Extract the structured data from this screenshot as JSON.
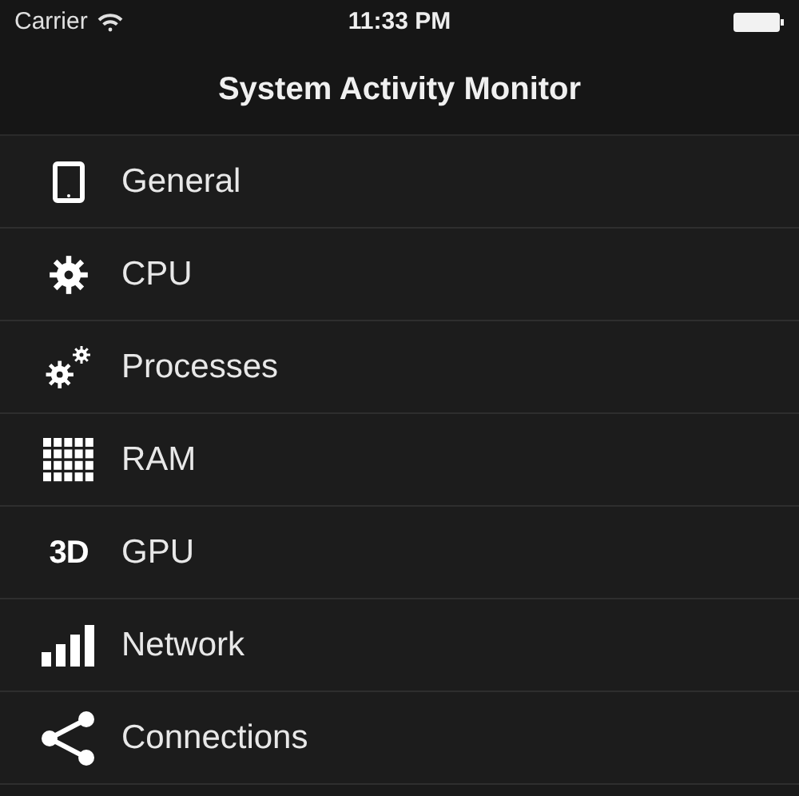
{
  "status_bar": {
    "carrier": "Carrier",
    "time": "11:33 PM"
  },
  "nav_bar": {
    "title": "System Activity Monitor"
  },
  "menu": [
    {
      "label": "General",
      "kind": "tablet"
    },
    {
      "label": "CPU",
      "kind": "gear"
    },
    {
      "label": "Processes",
      "kind": "gears"
    },
    {
      "label": "RAM",
      "kind": "grid"
    },
    {
      "label": "GPU",
      "kind": "text",
      "icon_text": "3D"
    },
    {
      "label": "Network",
      "kind": "bars"
    },
    {
      "label": "Connections",
      "kind": "share"
    }
  ]
}
